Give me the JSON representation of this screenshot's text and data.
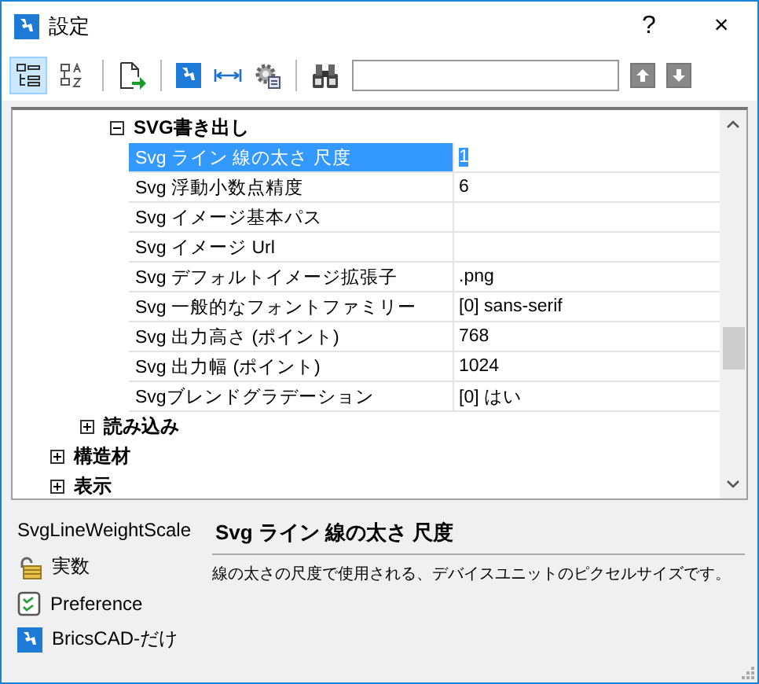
{
  "window": {
    "title": "設定",
    "help": "?",
    "close": "×"
  },
  "toolbar": {
    "views": [
      {
        "selected": true
      },
      {
        "selected": false
      }
    ]
  },
  "tree": [
    {
      "children": [
        {
          "children": [
            {
              "label": "SVG書き出し",
              "expanded": true,
              "properties": [
                {
                  "name": "Svg ライン 線の太さ 尺度",
                  "value": "1",
                  "selected": true
                },
                {
                  "name": "Svg 浮動小数点精度",
                  "value": "6",
                  "selected": false
                },
                {
                  "name": "Svg イメージ基本パス",
                  "selected": false
                },
                {
                  "name": "Svg イメージ Url",
                  "selected": false
                },
                {
                  "name": "Svg デフォルトイメージ拡張子",
                  "value": ".png",
                  "selected": false
                },
                {
                  "name": "Svg 一般的なフォントファミリー",
                  "value": "[0] sans-serif",
                  "selected": false
                },
                {
                  "name": "Svg 出力高さ (ポイント)",
                  "value": "768",
                  "selected": false
                },
                {
                  "name": "Svg 出力幅 (ポイント)",
                  "value": "1024",
                  "selected": false
                },
                {
                  "name": "Svgブレンドグラデーション",
                  "value": "[0] はい",
                  "selected": false
                }
              ]
            }
          ]
        },
        {
          "label": "読み込み",
          "expanded": false
        }
      ]
    },
    {
      "label": "構造材",
      "expanded": false
    },
    {
      "label": "表示",
      "expanded": false
    }
  ],
  "details": {
    "variable": "SvgLineWeightScale",
    "attributes": [
      {
        "kind": "type",
        "label": "実数"
      },
      {
        "kind": "category",
        "label": "Preference"
      },
      {
        "kind": "product",
        "label": "BricsCAD-だけ"
      }
    ],
    "title": "Svg ライン 線の太さ 尺度",
    "description": "線の太さの尺度で使用される、デバイスユニットのピクセルサイズです。"
  }
}
